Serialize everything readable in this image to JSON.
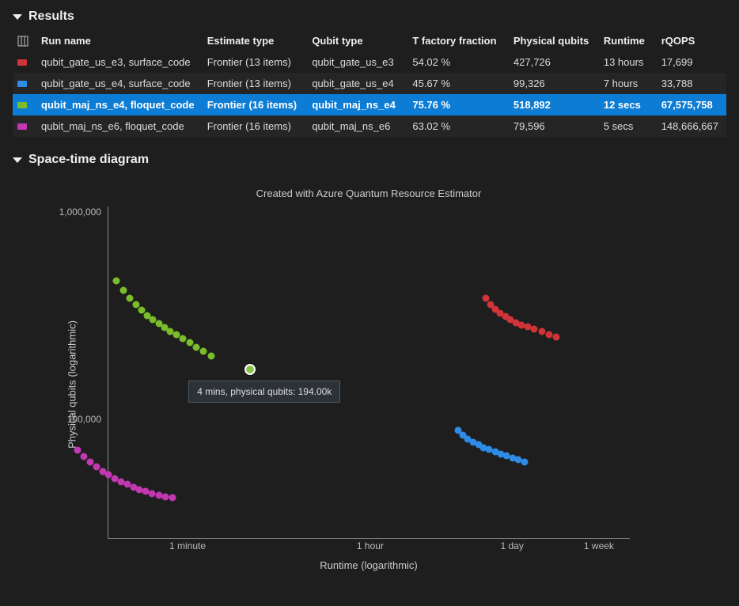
{
  "sections": {
    "results_title": "Results",
    "spacetime_title": "Space-time diagram"
  },
  "table": {
    "headers": {
      "run_name": "Run name",
      "estimate_type": "Estimate type",
      "qubit_type": "Qubit type",
      "t_factory": "T factory fraction",
      "physical_qubits": "Physical qubits",
      "runtime": "Runtime",
      "rqops": "rQOPS"
    },
    "rows": [
      {
        "color": "#D13438",
        "run_name": "qubit_gate_us_e3, surface_code",
        "estimate_type": "Frontier (13 items)",
        "qubit_type": "qubit_gate_us_e3",
        "t_factory": "54.02 %",
        "physical_qubits": "427,726",
        "runtime": "13 hours",
        "rqops": "17,699",
        "selected": false
      },
      {
        "color": "#2E8BE6",
        "run_name": "qubit_gate_us_e4, surface_code",
        "estimate_type": "Frontier (13 items)",
        "qubit_type": "qubit_gate_us_e4",
        "t_factory": "45.67 %",
        "physical_qubits": "99,326",
        "runtime": "7 hours",
        "rqops": "33,788",
        "selected": false
      },
      {
        "color": "#7ABD2A",
        "run_name": "qubit_maj_ns_e4, floquet_code",
        "estimate_type": "Frontier (16 items)",
        "qubit_type": "qubit_maj_ns_e4",
        "t_factory": "75.76 %",
        "physical_qubits": "518,892",
        "runtime": "12 secs",
        "rqops": "67,575,758",
        "selected": true
      },
      {
        "color": "#C238B2",
        "run_name": "qubit_maj_ns_e6, floquet_code",
        "estimate_type": "Frontier (16 items)",
        "qubit_type": "qubit_maj_ns_e6",
        "t_factory": "63.02 %",
        "physical_qubits": "79,596",
        "runtime": "5 secs",
        "rqops": "148,666,667",
        "selected": false
      }
    ]
  },
  "chart_data": {
    "type": "scatter",
    "title": "Created with Azure Quantum Resource Estimator",
    "xlabel": "Runtime (logarithmic)",
    "ylabel": "Physical qubits (logarithmic)",
    "x_axis_scale": "log",
    "y_axis_scale": "log",
    "x_range_seconds": [
      10,
      1209600
    ],
    "y_range_qubits": [
      30000,
      1200000
    ],
    "x_ticks": [
      {
        "label": "1 minute",
        "seconds": 60
      },
      {
        "label": "1 hour",
        "seconds": 3600
      },
      {
        "label": "1 day",
        "seconds": 86400
      },
      {
        "label": "1 week",
        "seconds": 604800
      }
    ],
    "y_ticks": [
      {
        "label": "100,000",
        "value": 100000
      },
      {
        "label": "1,000,000",
        "value": 1000000
      }
    ],
    "series": [
      {
        "name": "qubit_gate_us_e3, surface_code",
        "color": "#D13438",
        "points_seconds_qubits": [
          [
            46800,
            427726
          ],
          [
            52000,
            400000
          ],
          [
            58000,
            380000
          ],
          [
            65000,
            365000
          ],
          [
            73000,
            350000
          ],
          [
            82000,
            338000
          ],
          [
            92000,
            328000
          ],
          [
            105000,
            320000
          ],
          [
            120000,
            312000
          ],
          [
            140000,
            304000
          ],
          [
            165000,
            296000
          ],
          [
            195000,
            288000
          ],
          [
            230000,
            280000
          ]
        ]
      },
      {
        "name": "qubit_gate_us_e4, surface_code",
        "color": "#2E8BE6",
        "points_seconds_qubits": [
          [
            25200,
            99326
          ],
          [
            28000,
            94000
          ],
          [
            31500,
            90000
          ],
          [
            35500,
            87000
          ],
          [
            40000,
            84500
          ],
          [
            45000,
            82000
          ],
          [
            51000,
            80000
          ],
          [
            58000,
            78000
          ],
          [
            66000,
            76000
          ],
          [
            75000,
            74500
          ],
          [
            86000,
            73000
          ],
          [
            98000,
            71500
          ],
          [
            112000,
            70000
          ]
        ]
      },
      {
        "name": "qubit_maj_ns_e4, floquet_code",
        "color": "#7ABD2A",
        "points_seconds_qubits": [
          [
            12,
            518892
          ],
          [
            14,
            470000
          ],
          [
            16,
            430000
          ],
          [
            18.5,
            400000
          ],
          [
            21,
            375000
          ],
          [
            24,
            355000
          ],
          [
            27,
            338000
          ],
          [
            31,
            324000
          ],
          [
            35,
            310000
          ],
          [
            40,
            298000
          ],
          [
            46,
            286000
          ],
          [
            53,
            274000
          ],
          [
            62,
            262000
          ],
          [
            72,
            250000
          ],
          [
            84,
            238000
          ],
          [
            100,
            226000
          ]
        ]
      },
      {
        "name": "qubit_maj_ns_e6, floquet_code",
        "color": "#C238B2",
        "points_seconds_qubits": [
          [
            5,
            79596
          ],
          [
            5.8,
            74000
          ],
          [
            6.7,
            69500
          ],
          [
            7.7,
            66000
          ],
          [
            8.8,
            63000
          ],
          [
            10,
            60500
          ],
          [
            11.5,
            58200
          ],
          [
            13.2,
            56200
          ],
          [
            15.2,
            54400
          ],
          [
            17.5,
            52800
          ],
          [
            20,
            51400
          ],
          [
            23,
            50200
          ],
          [
            26.5,
            49200
          ],
          [
            31,
            48200
          ],
          [
            36,
            47400
          ],
          [
            42,
            46800
          ]
        ]
      }
    ],
    "highlight": {
      "series": "qubit_maj_ns_e4, floquet_code",
      "runtime_seconds": 240,
      "physical_qubits": 194000,
      "tooltip": "4 mins, physical qubits: 194.00k"
    }
  }
}
